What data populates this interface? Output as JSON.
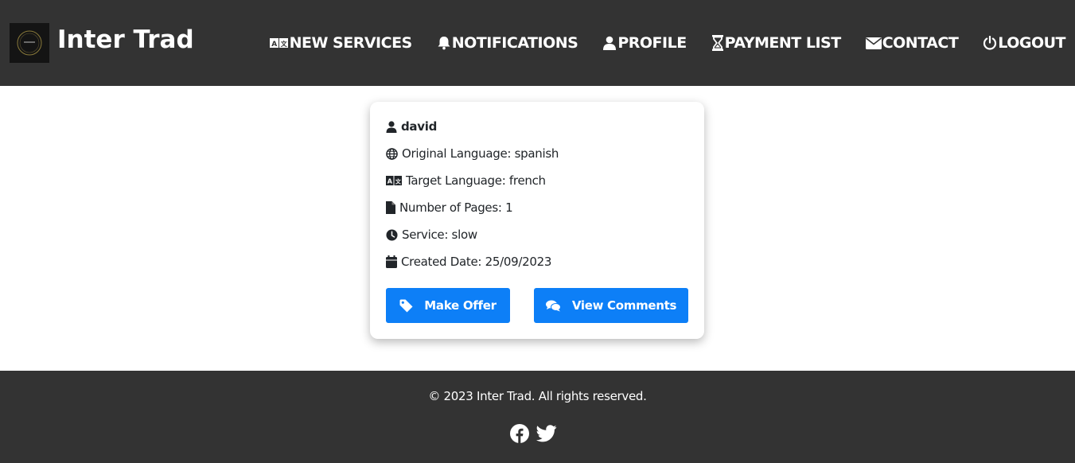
{
  "header": {
    "brand": "Inter Trad",
    "nav": [
      {
        "label": "NEW SERVICES",
        "icon": "language-icon"
      },
      {
        "label": "NOTIFICATIONS",
        "icon": "bell-icon"
      },
      {
        "label": "PROFILE",
        "icon": "user-icon"
      },
      {
        "label": "PAYMENT LIST",
        "icon": "hourglass-icon"
      },
      {
        "label": "CONTACT",
        "icon": "envelope-icon"
      },
      {
        "label": "LOGOUT",
        "icon": "power-icon"
      }
    ]
  },
  "card": {
    "user": "david",
    "original_language": "Original Language: spanish",
    "target_language": "Target Language: french",
    "pages": "Number of Pages: 1",
    "service": "Service: slow",
    "created": "Created Date: 25/09/2023",
    "make_offer": "Make Offer",
    "view_comments": "View Comments"
  },
  "footer": {
    "copyright": "© 2023 Inter Trad. All rights reserved.",
    "socials": [
      "facebook-icon",
      "twitter-icon"
    ]
  },
  "colors": {
    "nav_bg": "#333333",
    "accent": "#0d7ff7",
    "text": "#212529"
  }
}
